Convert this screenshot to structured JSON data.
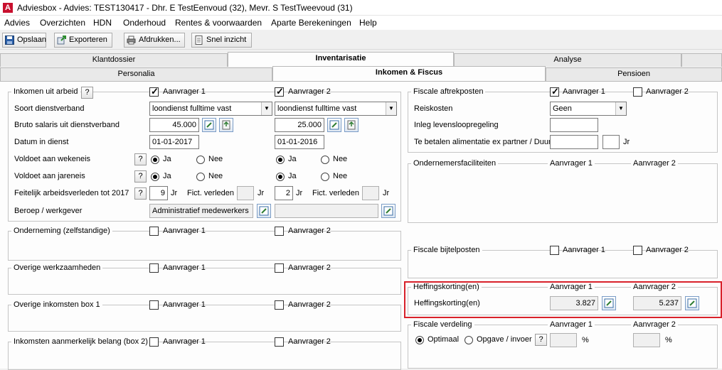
{
  "window": {
    "title": "Adviesbox - Advies: TEST130417 - Dhr. E TestEenvoud (32), Mevr. S TestTweevoud (31)",
    "icon_letter": "A"
  },
  "menu": [
    "Advies",
    "Overzichten",
    "HDN",
    "Onderhoud",
    "Rentes & voorwaarden",
    "Aparte Berekeningen",
    "Help"
  ],
  "toolbar": {
    "save": "Opslaan",
    "export": "Exporteren",
    "print": "Afdrukken...",
    "quick": "Snel inzicht"
  },
  "tabs_main": [
    "Klantdossier",
    "Inventarisatie",
    "Analyse"
  ],
  "tabs_sub": [
    "Personalia",
    "Inkomen & Fiscus",
    "Pensioen"
  ],
  "common": {
    "applicant1": "Aanvrager 1",
    "applicant2": "Aanvrager 2",
    "yes": "Ja",
    "no": "Nee",
    "q": "?",
    "jr": "Jr",
    "pct": "%"
  },
  "income": {
    "title": "Inkomen uit arbeid",
    "employment_label": "Soort dienstverband",
    "employment_a1": "loondienst fulltime vast",
    "employment_a2": "loondienst fulltime vast",
    "salary_label": "Bruto salaris uit dienstverband",
    "salary_a1": "45.000",
    "salary_a2": "25.000",
    "date_label": "Datum in dienst",
    "date_a1": "01-01-2017",
    "date_a2": "01-01-2016",
    "week_label": "Voldoet aan wekeneis",
    "year_label": "Voldoet aan jareneis",
    "work_label": "Feitelijk arbeidsverleden tot 2017",
    "work_a1": "9",
    "work_a2": "2",
    "fict_label": "Fict. verleden",
    "job_label": "Beroep / werkgever",
    "job_a1": "Administratief medewerkers",
    "job_a2": ""
  },
  "sections_left": [
    "Onderneming (zelfstandige)",
    "Overige werkzaamheden",
    "Overige inkomsten box 1",
    "Inkomsten aanmerkelijk belang (box 2)"
  ],
  "fiscal": {
    "title": "Fiscale aftrekposten",
    "travel_label": "Reiskosten",
    "travel_value": "Geen",
    "levens_label": "Inleg levensloopregeling",
    "alim_label": "Te betalen alimentatie ex partner / Duur"
  },
  "ondernemers": {
    "title": "Ondernemersfaciliteiten"
  },
  "bijtel": {
    "title": "Fiscale bijtelposten"
  },
  "heffing": {
    "title": "Heffingskorting(en)",
    "row_label": "Heffingskorting(en)",
    "a1": "3.827",
    "a2": "5.237"
  },
  "verdeling": {
    "title": "Fiscale verdeling",
    "optimal": "Optimaal",
    "custom": "Opgave / invoer"
  }
}
